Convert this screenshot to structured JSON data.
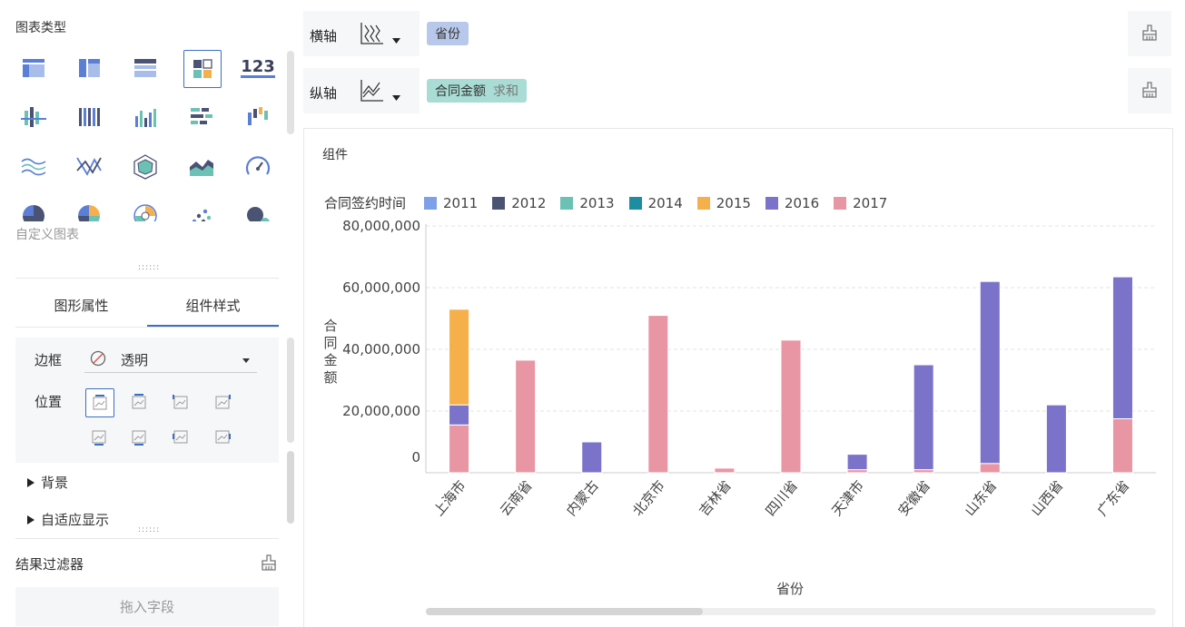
{
  "left_panel": {
    "chart_types_title": "图表类型",
    "custom_chart_label": "自定义图表",
    "chart_type_icons": [
      "table-icon",
      "cross-table-icon",
      "detail-table-icon",
      "dashboard-grid-icon",
      "number-123-icon",
      "stacked-column-icon",
      "multi-column-icon",
      "grouped-column-icon",
      "bar-icon",
      "waterfall-icon",
      "line-wave-icon",
      "line-cross-icon",
      "radar-icon",
      "area-icon",
      "gauge-icon",
      "pie-icon",
      "donut-icon",
      "rose-icon",
      "scatter-icon",
      "bubble-icon"
    ],
    "number_icon_text": "123",
    "tabs": [
      {
        "label": "图形属性",
        "active": false
      },
      {
        "label": "组件样式",
        "active": true
      }
    ],
    "style": {
      "border_label": "边框",
      "border_value": "透明",
      "position_label": "位置"
    },
    "expanders": [
      "背景",
      "自适应显示"
    ],
    "result_filter_label": "结果过滤器",
    "drop_hint": "拖入字段"
  },
  "axes": {
    "x_label": "横轴",
    "y_label": "纵轴",
    "x_field": "省份",
    "y_field": "合同金额",
    "y_agg": "求和"
  },
  "component_title": "组件",
  "chart_data": {
    "type": "bar",
    "stacked": true,
    "legend_title": "合同签约时间",
    "legend_position": "top-left",
    "xlabel": "省份",
    "ylabel": "合同金额",
    "categories": [
      "上海市",
      "云南省",
      "内蒙古",
      "北京市",
      "吉林省",
      "四川省",
      "天津市",
      "安徽省",
      "山东省",
      "山西省",
      "广东省"
    ],
    "yticks": [
      "80,000,000",
      "60,000,000",
      "40,000,000",
      "20,000,000",
      "0"
    ],
    "ylim": [
      0,
      80000000
    ],
    "grid": true,
    "series": [
      {
        "name": "2011",
        "color": "#7ea0e8",
        "values": [
          0,
          0,
          0,
          0,
          0,
          0,
          0,
          0,
          0,
          0,
          0
        ]
      },
      {
        "name": "2012",
        "color": "#4a5373",
        "values": [
          0,
          0,
          0,
          0,
          0,
          0,
          0,
          0,
          0,
          0,
          0
        ]
      },
      {
        "name": "2013",
        "color": "#6cc1b5",
        "values": [
          0,
          0,
          0,
          0,
          0,
          0,
          0,
          0,
          0,
          0,
          0
        ]
      },
      {
        "name": "2014",
        "color": "#1e8ca1",
        "values": [
          0,
          0,
          0,
          0,
          0,
          0,
          0,
          0,
          0,
          0,
          0
        ]
      },
      {
        "name": "2015",
        "color": "#f6b04b",
        "values": [
          31000000,
          0,
          0,
          0,
          0,
          0,
          0,
          0,
          0,
          0,
          0
        ]
      },
      {
        "name": "2016",
        "color": "#7b73c9",
        "values": [
          6500000,
          0,
          10000000,
          0,
          0,
          0,
          5000000,
          34000000,
          59000000,
          22000000,
          46000000
        ]
      },
      {
        "name": "2017",
        "color": "#e896a4",
        "values": [
          15500000,
          36500000,
          0,
          51000000,
          1500000,
          43000000,
          1000000,
          1000000,
          3000000,
          0,
          17500000
        ]
      }
    ]
  }
}
